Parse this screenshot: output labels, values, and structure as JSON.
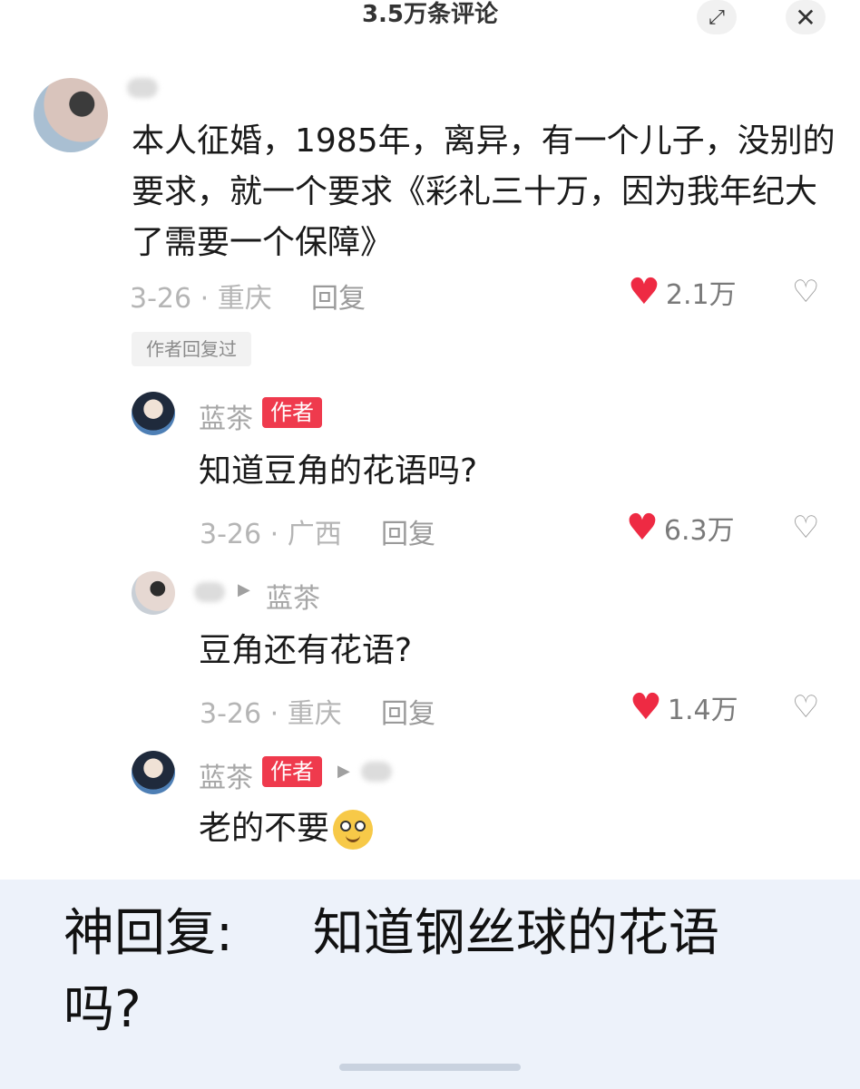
{
  "header": {
    "title": "3.5万条评论",
    "expand_icon": "expand-icon",
    "close_icon": "✕"
  },
  "main_comment": {
    "text": "本人征婚，1985年，离异，有一个儿子，没别的要求，就一个要求《彩礼三十万，因为我年纪大了需要一个保障》",
    "date_location": "3-26 · 重庆",
    "reply_label": "回复",
    "likes": "2.1万",
    "author_replied_label": "作者回复过"
  },
  "replies": [
    {
      "name": "蓝茶",
      "badge": "作者",
      "text": "知道豆角的花语吗?",
      "date_location": "3-26 · 广西",
      "reply_label": "回复",
      "likes": "6.3万"
    },
    {
      "reply_to": "蓝茶",
      "text": "豆角还有花语?",
      "date_location": "3-26 · 重庆",
      "reply_label": "回复",
      "likes": "1.4万"
    },
    {
      "name": "蓝茶",
      "badge": "作者",
      "text": "老的不要"
    }
  ],
  "caption": {
    "prefix": "神回复:",
    "answer": "知道钢丝球的花语吗?"
  },
  "colors": {
    "heart": "#ee2a43",
    "author_badge": "#ef3a4d",
    "caption_bg": "#edf2fa"
  }
}
